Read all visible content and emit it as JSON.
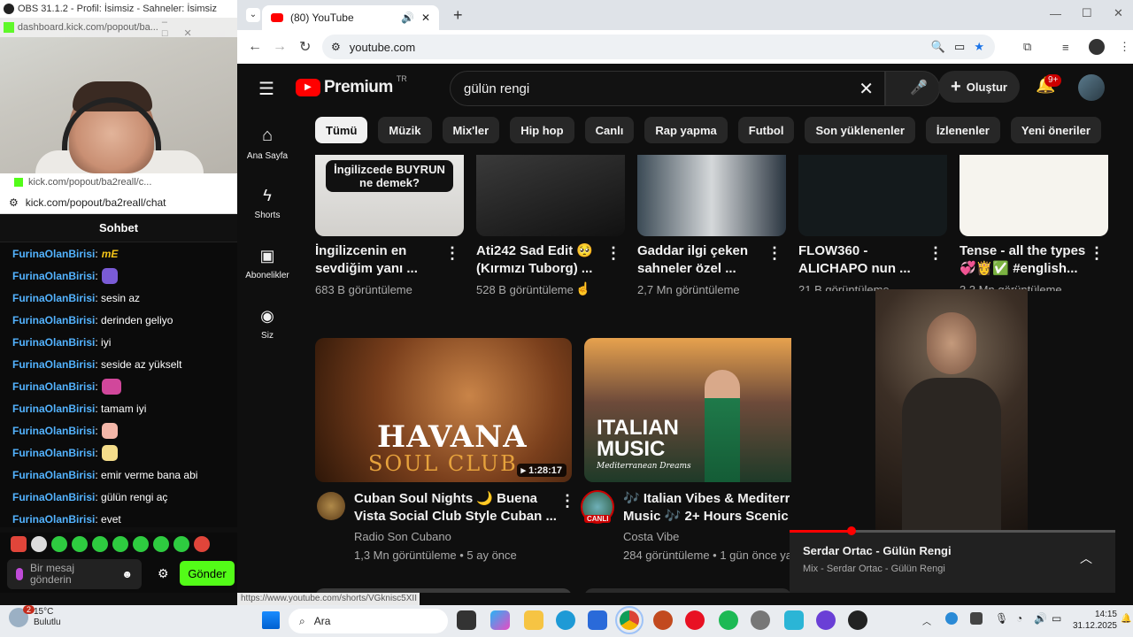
{
  "obs": {
    "title": "OBS 31.1.2 - Profil: İsimsiz - Sahneler: İsimsiz"
  },
  "kick_popout_small": {
    "url": "dashboard.kick.com/popout/ba..."
  },
  "chat_window": {
    "bar_url": "kick.com/popout/ba2reall/c...",
    "url": "kick.com/popout/ba2reall/chat",
    "header": "Sohbet",
    "messages": [
      {
        "user": "FurinaOlanBirisi",
        "text": "",
        "emote": "mE-emote",
        "emote_text": "mE"
      },
      {
        "user": "FurinaOlanBirisi",
        "text": "",
        "emote": "purple-cat-emote"
      },
      {
        "user": "FurinaOlanBirisi",
        "text": "sesin az"
      },
      {
        "user": "FurinaOlanBirisi",
        "text": "derinden geliyo"
      },
      {
        "user": "FurinaOlanBirisi",
        "text": "iyi"
      },
      {
        "user": "FurinaOlanBirisi",
        "text": "seside az yükselt"
      },
      {
        "user": "FurinaOlanBirisi",
        "text": "",
        "emote": "frog-emote"
      },
      {
        "user": "FurinaOlanBirisi",
        "text": "tamam iyi"
      },
      {
        "user": "FurinaOlanBirisi",
        "text": "",
        "emote": "pink-girl-emote"
      },
      {
        "user": "FurinaOlanBirisi",
        "text": "",
        "emote": "blonde-girl-emote"
      },
      {
        "user": "FurinaOlanBirisi",
        "text": "emir verme bana abi"
      },
      {
        "user": "FurinaOlanBirisi",
        "text": "gülün rengi aç"
      },
      {
        "user": "FurinaOlanBirisi",
        "text": "evet"
      }
    ],
    "input_placeholder": "Bir mesaj gönderin",
    "send_label": "Gönder"
  },
  "browser": {
    "tab_title": "(80) YouTube",
    "url": "youtube.com"
  },
  "youtube": {
    "logo_text": "Premium",
    "country": "TR",
    "search_value": "gülün rengi",
    "create_label": "Oluştur",
    "notif_badge": "9+",
    "chips": [
      "Tümü",
      "Müzik",
      "Mix'ler",
      "Hip hop",
      "Canlı",
      "Rap yapma",
      "Futbol",
      "Son yüklenenler",
      "İzlenenler",
      "Yeni öneriler"
    ],
    "sidebar": [
      {
        "label": "Ana Sayfa",
        "icon": "home-icon"
      },
      {
        "label": "Shorts",
        "icon": "shorts-icon"
      },
      {
        "label": "Abonelikler",
        "icon": "subscriptions-icon"
      },
      {
        "label": "Siz",
        "icon": "you-icon"
      }
    ],
    "shorts": [
      {
        "title1": "İngilizcenin en",
        "title2": "sevdiğim yanı ...",
        "views": "683 B görüntüleme",
        "overlay1": "İngilizcede BUYRUN",
        "overlay2": "ne demek?"
      },
      {
        "title1": "Ati242 Sad Edit 🥺",
        "title2": "(Kırmızı Tuborg) ...",
        "views": "528 B görüntüleme"
      },
      {
        "title1": "Gaddar ilgi çeken",
        "title2": "sahneler özel ...",
        "views": "2,7 Mn görüntüleme"
      },
      {
        "title1": "FLOW360 -",
        "title2": "ALICHAPO nun ...",
        "views": "21 B görüntüleme"
      },
      {
        "title1": "Tense - all the types",
        "title2": "💞👸✅ #english...",
        "views": "3,3 Mn görüntüleme"
      }
    ],
    "videos": [
      {
        "thumb_big": "HAVANA",
        "thumb_small": "SOUL CLUB",
        "duration": "1:28:17",
        "title1": "Cuban Soul Nights 🌙 Buena",
        "title2": "Vista Social Club Style Cuban ...",
        "channel": "Radio Son Cubano",
        "meta": "1,3 Mn görüntüleme • 5 ay önce"
      },
      {
        "thumb_big1": "ITALIAN",
        "thumb_big2": "MUSIC",
        "thumb_small": "Mediterranean Dreams",
        "live_badge": "CANLI",
        "title1": "🎶 Italian Vibes & Mediterran",
        "title2": "Music 🎶 2+ Hours Scenic A",
        "channel": "Costa Vibe",
        "meta": "284 görüntüleme • 1 gün önce yay"
      }
    ],
    "miniplayer": {
      "title": "Serdar Ortac - Gülün Rengi",
      "subtitle": "Mix - Serdar Ortac - Gülün Rengi",
      "progress": 0.19
    }
  },
  "status_url": "https://www.youtube.com/shorts/VGknisc5XII",
  "taskbar": {
    "weather_badge": "2",
    "temp": "15°C",
    "weather": "Bulutlu",
    "search_label": "Ara",
    "time": "14:15",
    "date": "31.12.2025"
  }
}
